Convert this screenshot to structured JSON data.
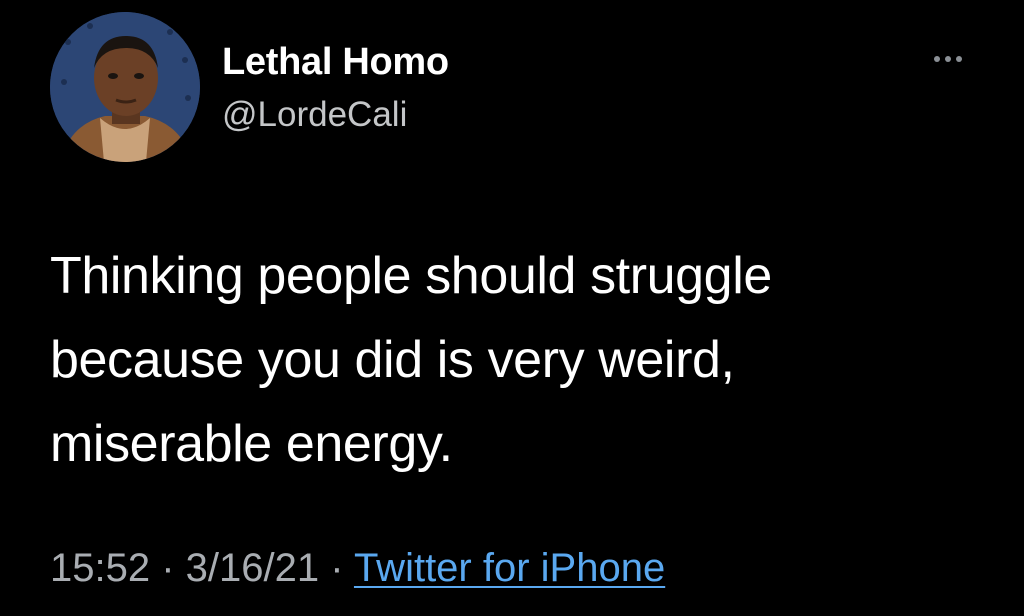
{
  "tweet": {
    "author": {
      "display_name": "Lethal Homo",
      "handle": "@LordeCali",
      "avatar_icon": "profile-photo-avatar"
    },
    "more_icon": "more-options-icon",
    "text_lines": [
      "Thinking people should struggle",
      "because you did is very weird,",
      "miserable energy."
    ],
    "meta": {
      "time": "15:52",
      "separator": " · ",
      "date": "3/16/21",
      "source": "Twitter for iPhone"
    }
  },
  "colors": {
    "background": "#000000",
    "primary_text": "#ffffff",
    "secondary_text": "#a9adb2",
    "link": "#5aa8f0"
  }
}
